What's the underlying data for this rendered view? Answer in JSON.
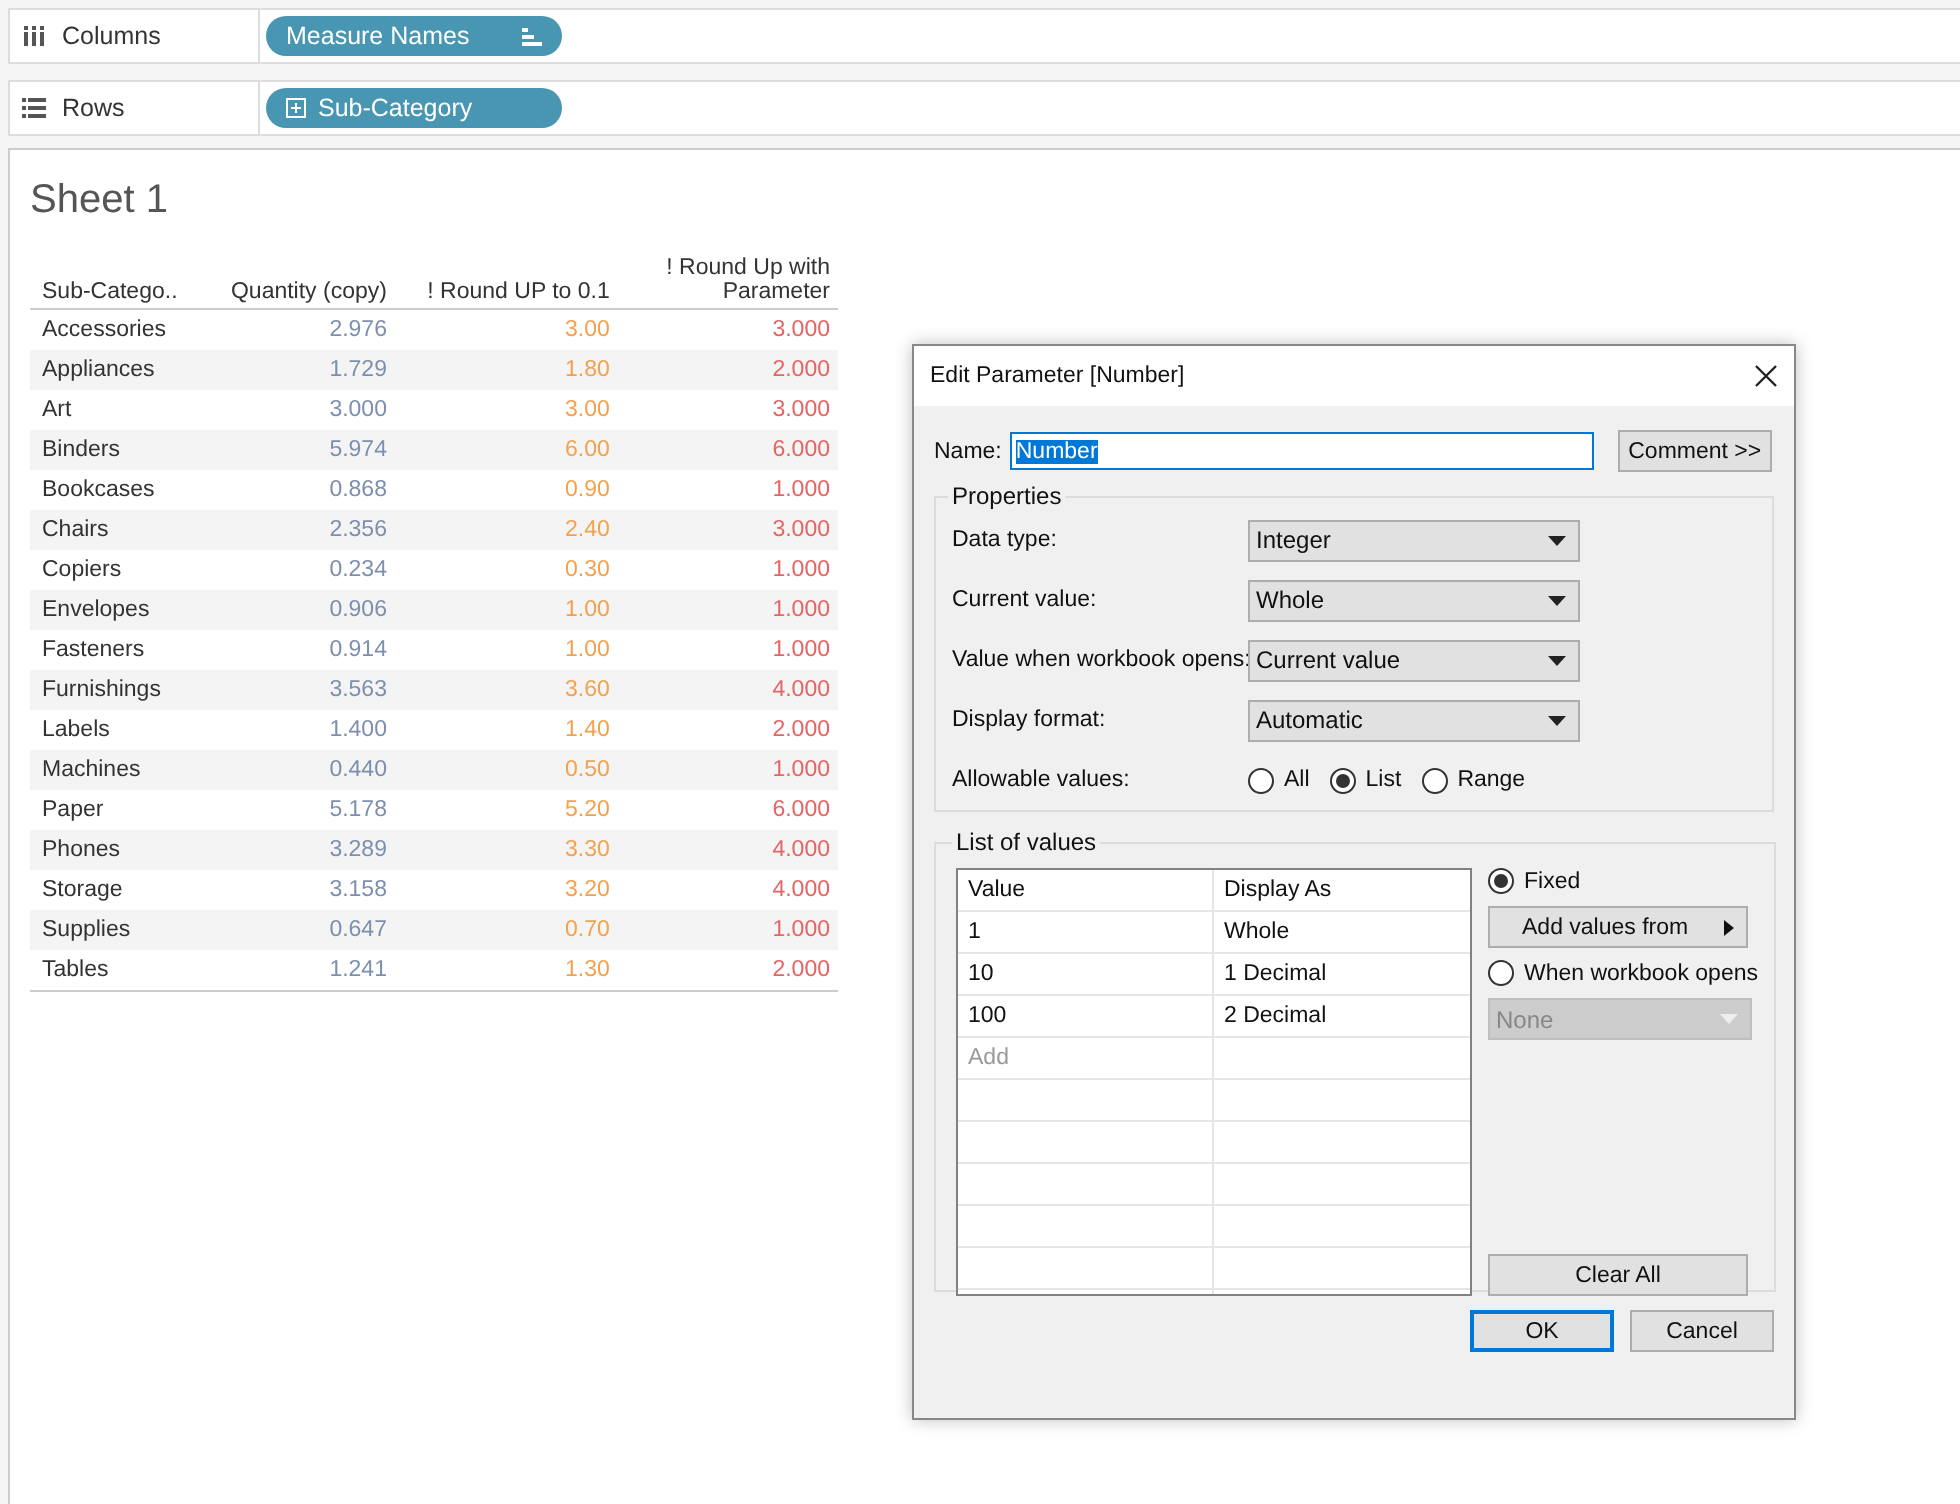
{
  "shelves": [
    {
      "kind": "columns",
      "label": "Columns",
      "pill": {
        "label": "Measure Names"
      }
    },
    {
      "kind": "rows",
      "label": "Rows",
      "pill": {
        "label": "Sub-Category"
      }
    }
  ],
  "sheet": {
    "title": "Sheet 1",
    "table": {
      "columns": [
        {
          "label": "Sub-Catego..",
          "color": "#333333"
        },
        {
          "label": "Quantity (copy)",
          "color": "#7d8fae"
        },
        {
          "label": "! Round UP to 0.1",
          "color": "#f2a24e"
        },
        {
          "label": "! Round Up with Parameter",
          "color": "#e46565"
        }
      ],
      "rows": [
        [
          "Accessories",
          "2.976",
          "3.00",
          "3.000"
        ],
        [
          "Appliances",
          "1.729",
          "1.80",
          "2.000"
        ],
        [
          "Art",
          "3.000",
          "3.00",
          "3.000"
        ],
        [
          "Binders",
          "5.974",
          "6.00",
          "6.000"
        ],
        [
          "Bookcases",
          "0.868",
          "0.90",
          "1.000"
        ],
        [
          "Chairs",
          "2.356",
          "2.40",
          "3.000"
        ],
        [
          "Copiers",
          "0.234",
          "0.30",
          "1.000"
        ],
        [
          "Envelopes",
          "0.906",
          "1.00",
          "1.000"
        ],
        [
          "Fasteners",
          "0.914",
          "1.00",
          "1.000"
        ],
        [
          "Furnishings",
          "3.563",
          "3.60",
          "4.000"
        ],
        [
          "Labels",
          "1.400",
          "1.40",
          "2.000"
        ],
        [
          "Machines",
          "0.440",
          "0.50",
          "1.000"
        ],
        [
          "Paper",
          "5.178",
          "5.20",
          "6.000"
        ],
        [
          "Phones",
          "3.289",
          "3.30",
          "4.000"
        ],
        [
          "Storage",
          "3.158",
          "3.20",
          "4.000"
        ],
        [
          "Supplies",
          "0.647",
          "0.70",
          "1.000"
        ],
        [
          "Tables",
          "1.241",
          "1.30",
          "2.000"
        ]
      ]
    }
  },
  "dialog": {
    "title": "Edit Parameter [Number]",
    "name_label": "Name:",
    "name_value": "Number",
    "comment_button": "Comment >>",
    "properties": {
      "title": "Properties",
      "fields": [
        {
          "label": "Data type:",
          "value": "Integer"
        },
        {
          "label": "Current value:",
          "value": "Whole"
        },
        {
          "label": "Value when workbook opens:",
          "value": "Current value"
        },
        {
          "label": "Display format:",
          "value": "Automatic"
        }
      ],
      "allowable": {
        "label": "Allowable values:",
        "options": [
          {
            "label": "All",
            "selected": false
          },
          {
            "label": "List",
            "selected": true
          },
          {
            "label": "Range",
            "selected": false
          }
        ]
      }
    },
    "list": {
      "title": "List of values",
      "columns": [
        "Value",
        "Display As"
      ],
      "rows": [
        [
          "1",
          "Whole"
        ],
        [
          "10",
          "1 Decimal"
        ],
        [
          "100",
          "2 Decimal"
        ]
      ],
      "add_placeholder": "Add",
      "sources": [
        {
          "label": "Fixed",
          "selected": true
        },
        {
          "label": "When workbook opens",
          "selected": false
        }
      ],
      "add_values_button": "Add values from",
      "source_dropdown": {
        "value": "None",
        "disabled": true
      },
      "clear_button": "Clear All"
    },
    "buttons": [
      {
        "label": "OK",
        "default": true
      },
      {
        "label": "Cancel",
        "default": false
      }
    ]
  }
}
